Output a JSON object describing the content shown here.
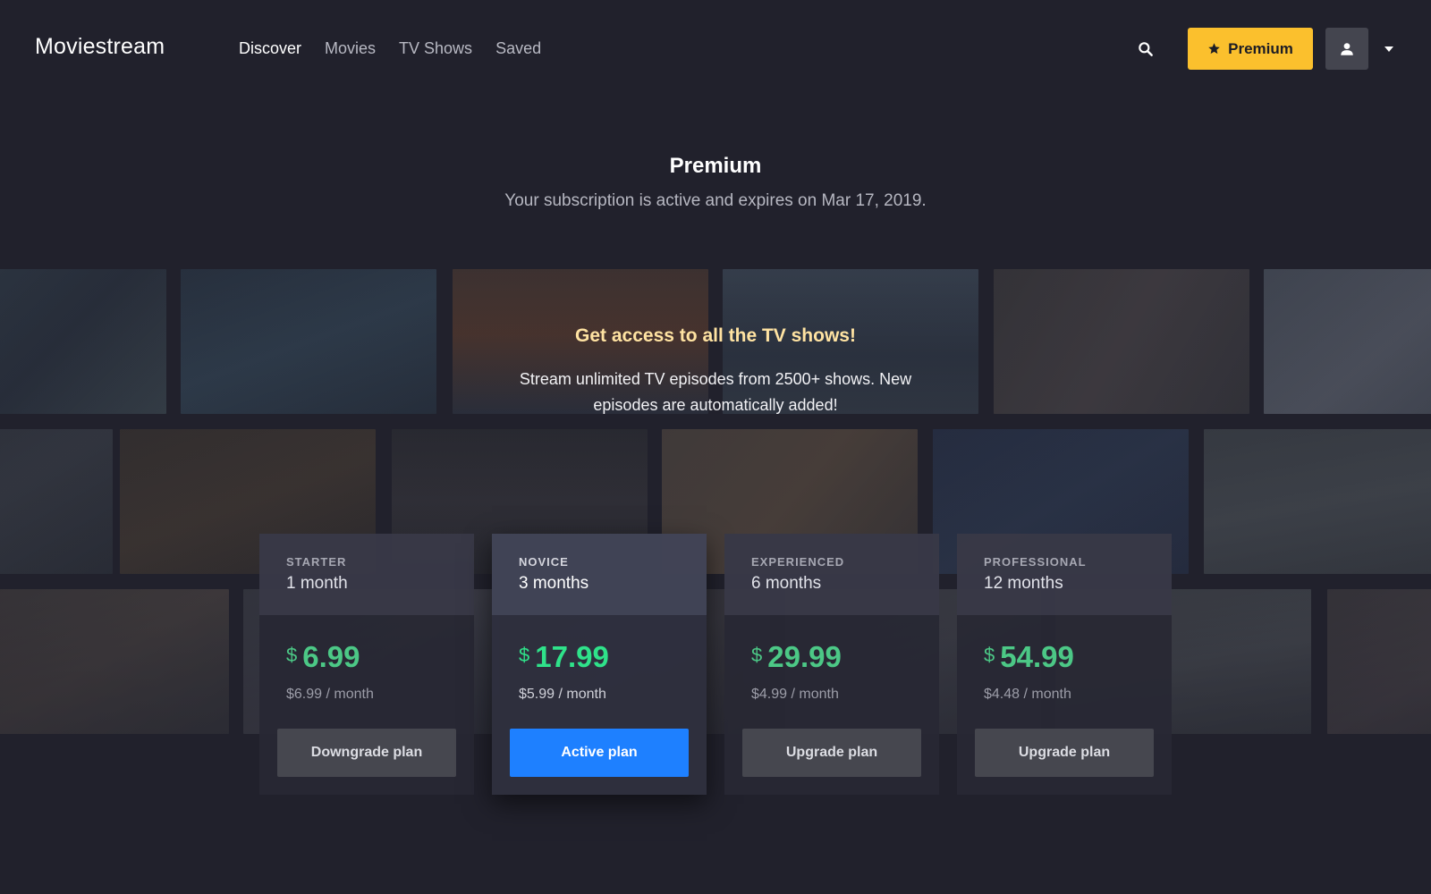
{
  "header": {
    "brand": "Moviestream",
    "nav": [
      {
        "label": "Discover",
        "active": true
      },
      {
        "label": "Movies",
        "active": false
      },
      {
        "label": "TV Shows",
        "active": false
      },
      {
        "label": "Saved",
        "active": false
      }
    ],
    "search_icon": "search-icon",
    "premium_button": {
      "label": "Premium",
      "icon": "star-icon",
      "color": "#fbc02d"
    },
    "account_icon": "user-icon",
    "menu_icon": "caret-down-icon"
  },
  "page": {
    "title": "Premium",
    "subtitle": "Your subscription is active and expires on Mar 17, 2019."
  },
  "promo": {
    "title": "Get access to all the TV shows!",
    "text": "Stream unlimited TV episodes from 2500+ shows. New episodes are automatically added!"
  },
  "plans": [
    {
      "tier": "STARTER",
      "duration": "1 month",
      "currency": "$",
      "price": "6.99",
      "per_month": "$6.99 / month",
      "button": "Downgrade plan",
      "active": false
    },
    {
      "tier": "NOVICE",
      "duration": "3 months",
      "currency": "$",
      "price": "17.99",
      "per_month": "$5.99 / month",
      "button": "Active plan",
      "active": true
    },
    {
      "tier": "EXPERIENCED",
      "duration": "6 months",
      "currency": "$",
      "price": "29.99",
      "per_month": "$4.99 / month",
      "button": "Upgrade plan",
      "active": false
    },
    {
      "tier": "PROFESSIONAL",
      "duration": "12 months",
      "currency": "$",
      "price": "54.99",
      "per_month": "$4.48 / month",
      "button": "Upgrade plan",
      "active": false
    }
  ],
  "colors": {
    "background": "#21212c",
    "accent_yellow": "#fbc02d",
    "active_blue": "#1e80ff",
    "price_green": "#4cc886",
    "promo_title": "#ffe3a2"
  }
}
